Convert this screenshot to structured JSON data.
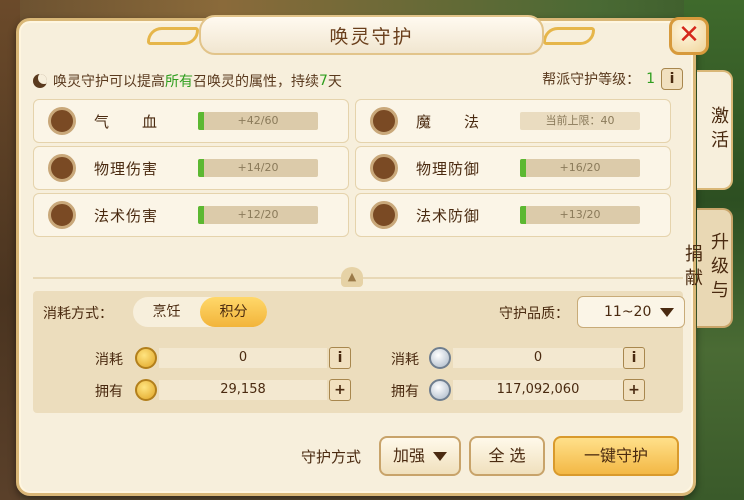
{
  "window": {
    "title": "唤灵守护",
    "close_icon": "close-icon"
  },
  "info": {
    "text_prefix": "唤灵守护可以提高",
    "text_highlight": "所有",
    "text_mid": "召唤灵的属性，持续",
    "text_days": "7",
    "text_suffix": "天",
    "guild_level_label": "帮派守护等级：",
    "guild_level_value": "1",
    "info_button": "i"
  },
  "attributes": [
    {
      "name": "气　　血",
      "value_text": "+42/60",
      "fill": 0.05
    },
    {
      "name": "魔　　法",
      "value_text": "当前上限：40",
      "fill": 0
    },
    {
      "name": "物理伤害",
      "value_text": "+14/20",
      "fill": 0.05
    },
    {
      "name": "物理防御",
      "value_text": "+16/20",
      "fill": 0.05
    },
    {
      "name": "法术伤害",
      "value_text": "+12/20",
      "fill": 0.05
    },
    {
      "name": "法术防御",
      "value_text": "+13/20",
      "fill": 0.05
    }
  ],
  "consume": {
    "mode_label": "消耗方式：",
    "options": [
      "烹饪",
      "积分"
    ],
    "selected": "积分",
    "quality_label": "守护品质：",
    "quality_value": "11~20",
    "left": {
      "cost_label": "消耗",
      "cost_value": "0",
      "own_label": "拥有",
      "own_value": "29,158"
    },
    "right": {
      "cost_label": "消耗",
      "cost_value": "0",
      "own_label": "拥有",
      "own_value": "117,092,060"
    },
    "info_btn": "i",
    "add_btn": "+"
  },
  "bottom": {
    "mode_label": "守护方式",
    "mode_value": "加强",
    "select_all": "全 选",
    "one_click": "一键守护"
  },
  "tabs": [
    {
      "label": "激活"
    },
    {
      "label": "升级与捐献"
    }
  ],
  "colors": {
    "accent": "#f3b845",
    "highlight_green": "#2f9e1e",
    "progress_green": "#5cb832"
  }
}
